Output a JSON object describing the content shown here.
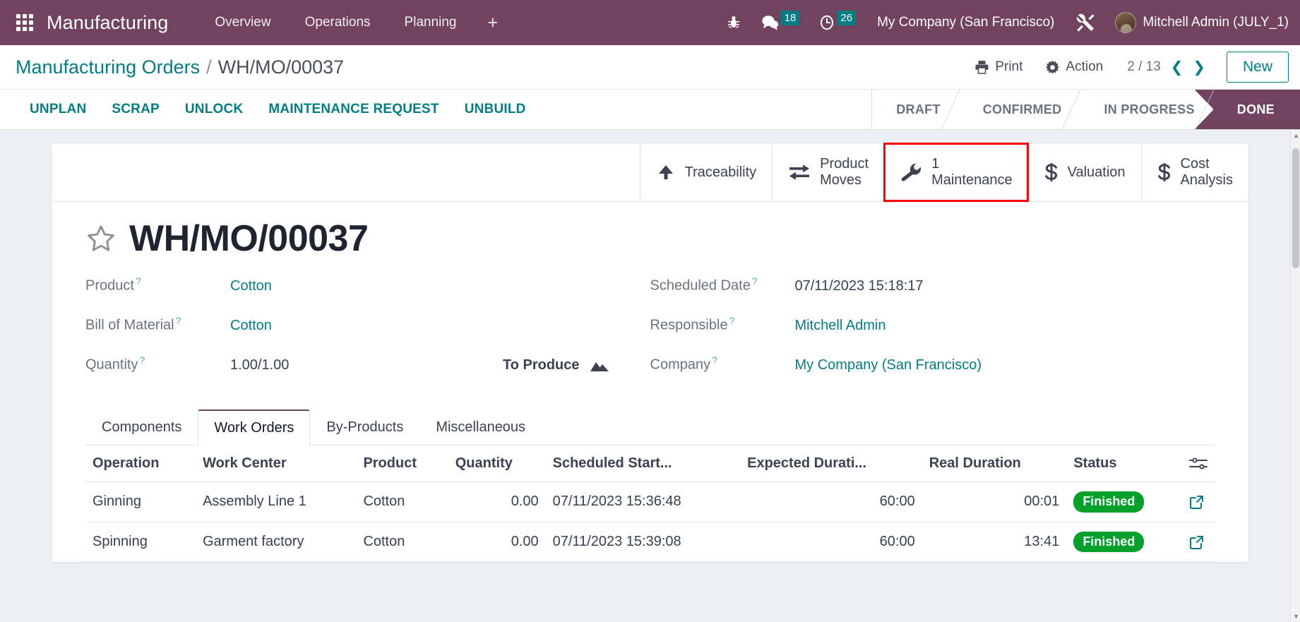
{
  "navbar": {
    "apps_icon": "apps-grid-icon",
    "brand": "Manufacturing",
    "menu": [
      {
        "label": "Overview"
      },
      {
        "label": "Operations"
      },
      {
        "label": "Planning"
      }
    ],
    "plus_label": "+",
    "icons": {
      "debug": "bug-icon",
      "messages": "chat-icon",
      "activities": "clock-icon",
      "tools": "tools-icon"
    },
    "messages_count": "18",
    "activities_count": "26",
    "company": "My Company (San Francisco)",
    "user": "Mitchell Admin (JULY_1)"
  },
  "control_panel": {
    "breadcrumb_root": "Manufacturing Orders",
    "breadcrumb_sep": "/",
    "breadcrumb_current": "WH/MO/00037",
    "print_label": "Print",
    "action_label": "Action",
    "pager": "2 / 13",
    "prev_glyph": "❮",
    "next_glyph": "❯",
    "new_label": "New"
  },
  "action_buttons": [
    {
      "label": "UNPLAN"
    },
    {
      "label": "SCRAP"
    },
    {
      "label": "UNLOCK"
    },
    {
      "label": "MAINTENANCE REQUEST"
    },
    {
      "label": "UNBUILD"
    }
  ],
  "statusbar": {
    "stages": [
      {
        "label": "DRAFT",
        "active": false
      },
      {
        "label": "CONFIRMED",
        "active": false
      },
      {
        "label": "IN PROGRESS",
        "active": false
      },
      {
        "label": "DONE",
        "active": true
      }
    ],
    "active_color": "#71435f"
  },
  "smart_buttons": [
    {
      "icon": "up-arrow-icon",
      "line1": "Traceability",
      "line2": "",
      "count": "",
      "highlighted": false
    },
    {
      "icon": "transfer-arrows-icon",
      "line1": "Product",
      "line2": "Moves",
      "count": "",
      "highlighted": false
    },
    {
      "icon": "wrench-icon",
      "line1": "Maintenance",
      "line2": "",
      "count": "1",
      "highlighted": true
    },
    {
      "icon": "dollar-icon",
      "line1": "Valuation",
      "line2": "",
      "count": "",
      "highlighted": false
    },
    {
      "icon": "dollar-icon",
      "line1": "Cost",
      "line2": "Analysis",
      "count": "",
      "highlighted": false
    }
  ],
  "highlight_color": "#ff0000",
  "record": {
    "star_icon": "star-icon",
    "title": "WH/MO/00037",
    "left_fields": [
      {
        "label": "Product",
        "value": "Cotton",
        "is_link": true
      },
      {
        "label": "Bill of Material",
        "value": "Cotton",
        "is_link": true
      },
      {
        "label": "Quantity",
        "value": "1.00/1.00",
        "is_link": false
      }
    ],
    "right_fields": [
      {
        "label": "Scheduled Date",
        "value": "07/11/2023 15:18:17",
        "is_link": false
      },
      {
        "label": "Responsible",
        "value": "Mitchell Admin",
        "is_link": true
      },
      {
        "label": "Company",
        "value": "My Company (San Francisco)",
        "is_link": true
      }
    ],
    "to_produce_label": "To Produce",
    "to_produce_icon": "mountains-icon"
  },
  "notebook": {
    "tabs": [
      {
        "label": "Components",
        "active": false
      },
      {
        "label": "Work Orders",
        "active": true
      },
      {
        "label": "By-Products",
        "active": false
      },
      {
        "label": "Miscellaneous",
        "active": false
      }
    ]
  },
  "work_orders_table": {
    "columns": [
      "Operation",
      "Work Center",
      "Product",
      "Quantity",
      "Scheduled Start...",
      "Expected Durati...",
      "Real Duration",
      "Status"
    ],
    "optional_columns_icon": "settings-sliders-icon",
    "rows": [
      {
        "operation": "Ginning",
        "work_center": "Assembly Line 1",
        "product": "Cotton",
        "quantity": "0.00",
        "scheduled_start": "07/11/2023 15:36:48",
        "expected_duration": "60:00",
        "real_duration": "00:01",
        "status": "Finished",
        "open_icon": "external-link-icon"
      },
      {
        "operation": "Spinning",
        "work_center": "Garment factory",
        "product": "Cotton",
        "quantity": "0.00",
        "scheduled_start": "07/11/2023 15:39:08",
        "expected_duration": "60:00",
        "real_duration": "13:41",
        "status": "Finished",
        "open_icon": "external-link-icon"
      }
    ],
    "status_badge_color": "#00a02b"
  }
}
